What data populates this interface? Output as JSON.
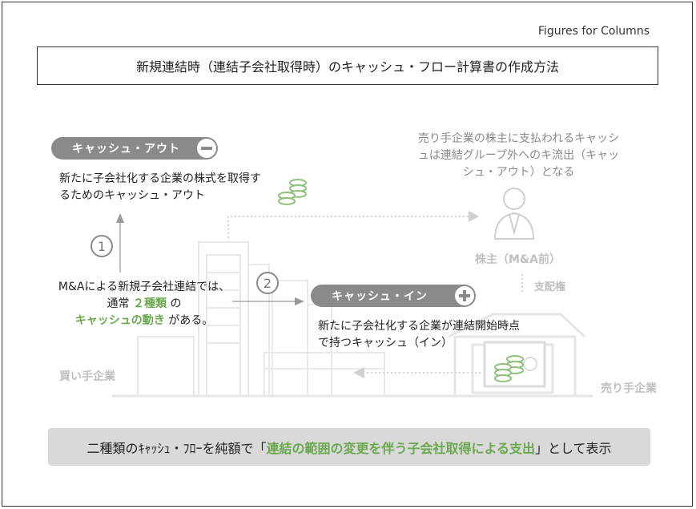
{
  "header_label": "Figures for Columns",
  "title": "新規連結時（連結子会社取得時）のキャッシュ・フロー計算書の作成方法",
  "cash_out": {
    "label": "キャッシュ・アウト",
    "description": "新たに子会社化する企業の株式を取得するためのキャッシュ・アウト"
  },
  "cash_in": {
    "label": "キャッシュ・イン",
    "description": "新たに子会社化する企業が連結開始時点で持つキャッシュ（イン）"
  },
  "seller_note": "売り手企業の株主に支払われるキャッシュは連結グループ外へのキ流出（キャッシュ・アウト）となる",
  "step1": "1",
  "step2": "2",
  "ma_text": {
    "part1": "M&Aによる新規子会社連結では、通常",
    "highlight1": "２種類",
    "part2": "の",
    "highlight2": "キャッシュの動き",
    "part3": "がある。"
  },
  "labels": {
    "shareholder": "株主（M&A前）",
    "control": "支配権",
    "buyer": "買い手企業",
    "seller": "売り手企業"
  },
  "summary": {
    "prefix": "二種類のｷｬｯｼｭ・ﾌﾛｰを純額で「",
    "highlight": "連結の範囲の変更を伴う子会社取得による支出",
    "suffix": "」として表示"
  },
  "colors": {
    "accent_green": "#6aa84f",
    "pill_gray": "#8a8a8a",
    "illustration_gray": "#e6e6e6",
    "summary_bg": "#d9d9d9"
  }
}
